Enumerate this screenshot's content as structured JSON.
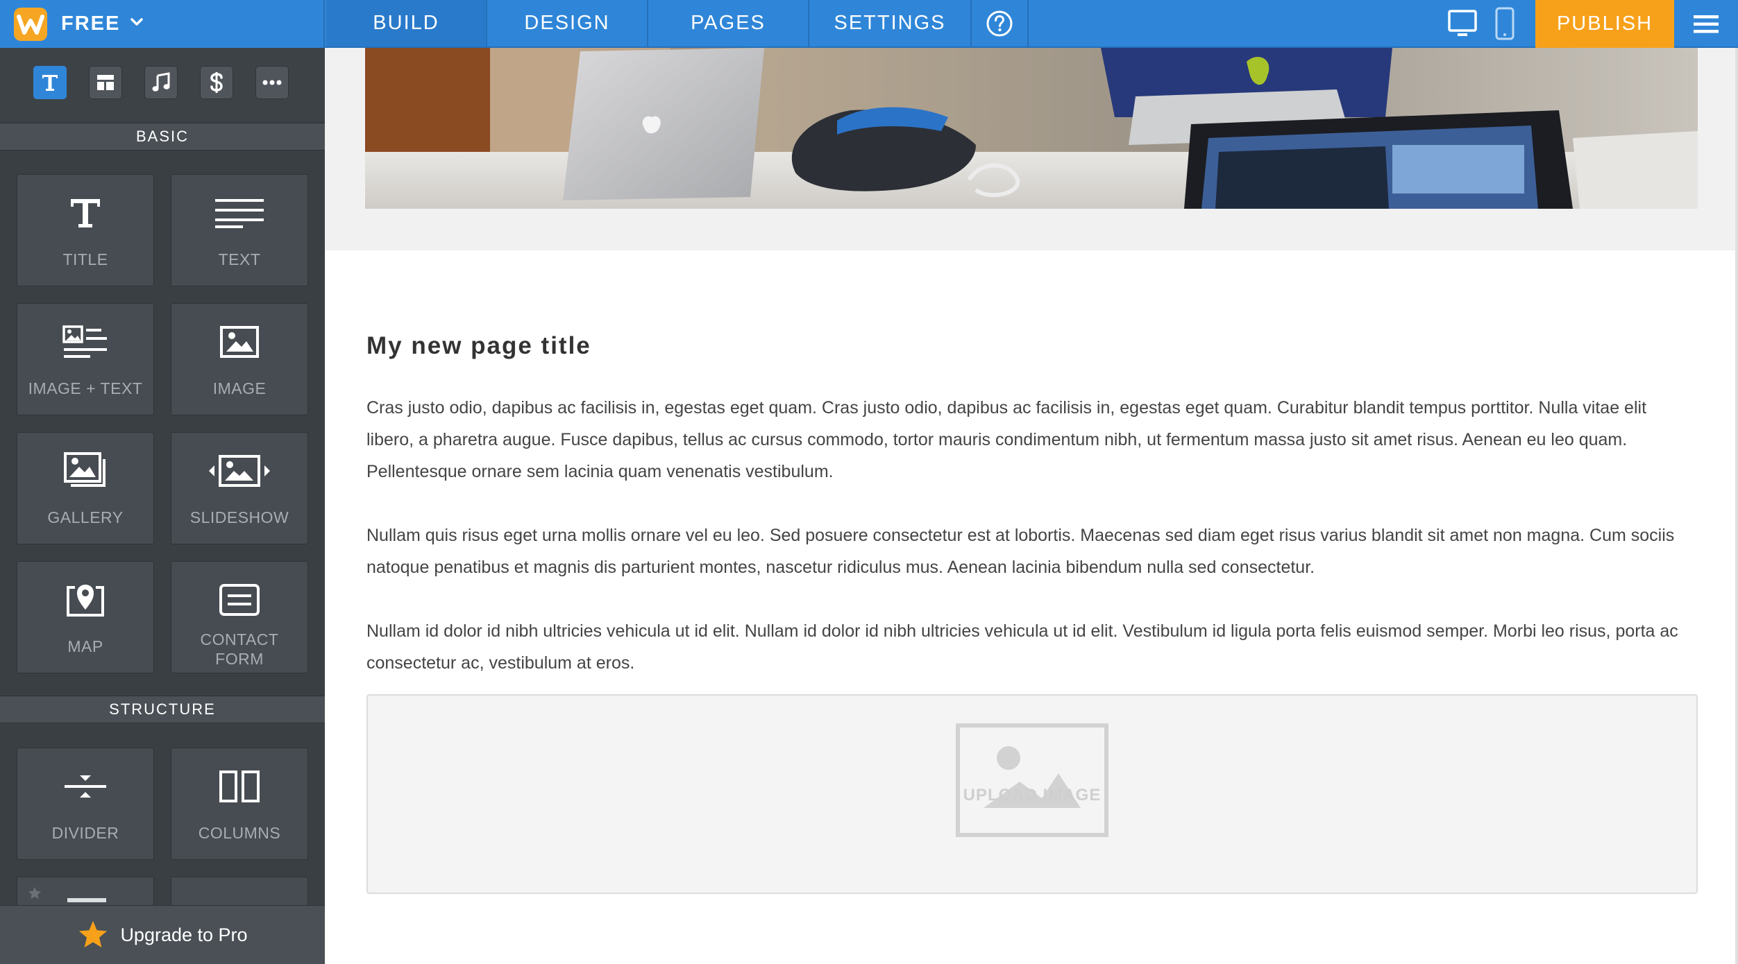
{
  "brand": {
    "logo_letter": "W",
    "plan": "FREE"
  },
  "nav": {
    "tabs": [
      {
        "label": "BUILD",
        "active": true
      },
      {
        "label": "DESIGN",
        "active": false
      },
      {
        "label": "PAGES",
        "active": false
      },
      {
        "label": "SETTINGS",
        "active": false
      }
    ],
    "help_icon": "question-circle-icon",
    "publish_label": "PUBLISH"
  },
  "sidebar": {
    "categories": [
      {
        "icon": "text-icon",
        "active": true
      },
      {
        "icon": "layout-icon",
        "active": false
      },
      {
        "icon": "music-note-icon",
        "active": false
      },
      {
        "icon": "dollar-icon",
        "active": false
      },
      {
        "icon": "more-icon",
        "active": false
      }
    ],
    "basic_label": "BASIC",
    "basic_items": [
      {
        "label": "TITLE",
        "icon": "title-icon"
      },
      {
        "label": "TEXT",
        "icon": "text-lines-icon"
      },
      {
        "label": "IMAGE + TEXT",
        "icon": "image-text-icon"
      },
      {
        "label": "IMAGE",
        "icon": "image-icon"
      },
      {
        "label": "GALLERY",
        "icon": "gallery-icon"
      },
      {
        "label": "SLIDESHOW",
        "icon": "slideshow-icon"
      },
      {
        "label": "MAP",
        "icon": "map-pin-icon"
      },
      {
        "label": "CONTACT",
        "label2": "FORM",
        "icon": "contact-form-icon"
      }
    ],
    "structure_label": "STRUCTURE",
    "structure_items": [
      {
        "label": "DIVIDER",
        "icon": "divider-icon"
      },
      {
        "label": "COLUMNS",
        "icon": "columns-icon"
      }
    ],
    "upgrade_label": "Upgrade to Pro"
  },
  "page": {
    "title": "My new page title",
    "paragraphs": [
      "Cras justo odio, dapibus ac facilisis in, egestas eget quam. Cras justo odio, dapibus ac facilisis in, egestas eget quam. Curabitur blandit tempus porttitor. Nulla vitae elit libero, a pharetra augue. Fusce dapibus, tellus ac cursus commodo, tortor mauris condimentum nibh, ut fermentum massa justo sit amet risus. Aenean eu leo quam. Pellentesque ornare sem lacinia quam venenatis vestibulum.",
      "Nullam quis risus eget urna mollis ornare vel eu leo. Sed posuere consectetur est at lobortis. Maecenas sed diam eget risus varius blandit sit amet non magna. Cum sociis natoque penatibus et magnis dis parturient montes, nascetur ridiculus mus. Aenean lacinia bibendum nulla sed consectetur.",
      "Nullam id dolor id nibh ultricies vehicula ut id elit. Nullam id dolor id nibh ultricies vehicula ut id elit. Vestibulum id ligula porta felis euismod semper. Morbi leo risus, porta ac consectetur ac, vestibulum at eros."
    ],
    "upload_label": "UPLOAD IMAGE"
  },
  "colors": {
    "topbar": "#2f86d8",
    "publish": "#f7a11a",
    "sidebar": "#3a3f44",
    "tile": "#474c52",
    "star": "#f7a11a"
  }
}
